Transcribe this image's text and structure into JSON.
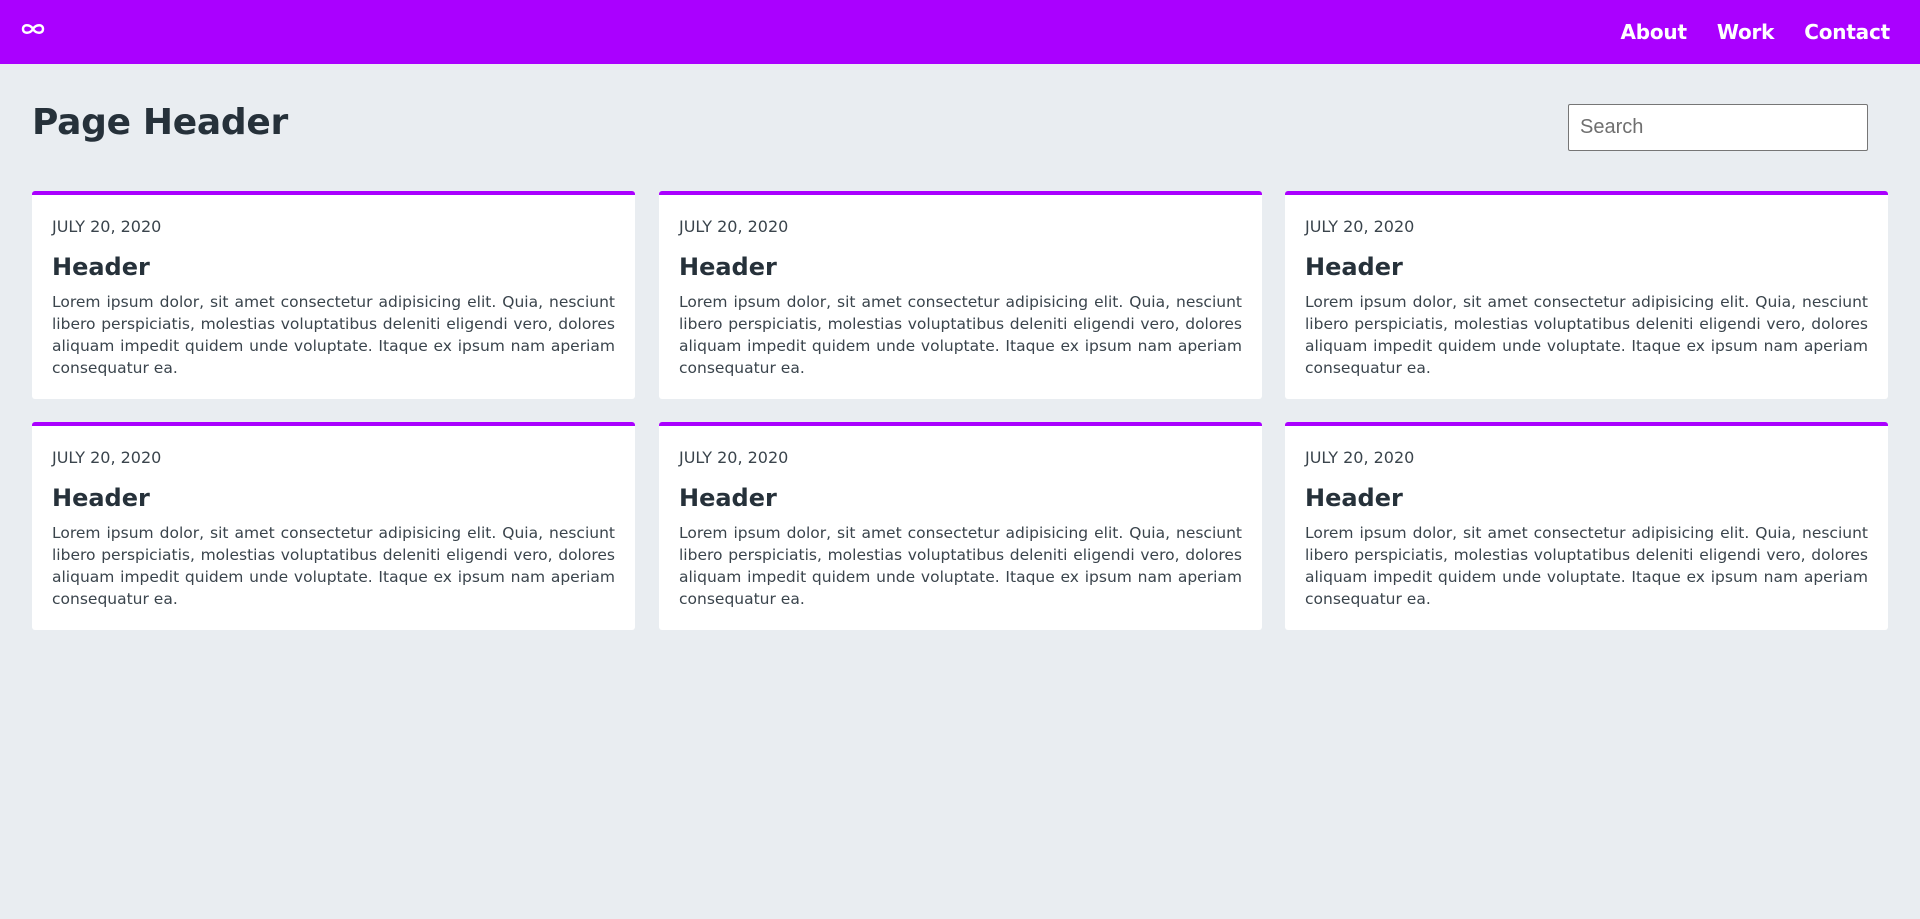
{
  "navbar": {
    "logo_icon": "infinity-icon",
    "links": [
      "About",
      "Work",
      "Contact"
    ],
    "background": "#aa00ff"
  },
  "page": {
    "title": "Page Header"
  },
  "search": {
    "placeholder": "Search",
    "value": ""
  },
  "cards": [
    {
      "date": "JULY 20, 2020",
      "header": "Header",
      "body": "Lorem ipsum dolor, sit amet consectetur adipisicing elit. Quia, nesciunt libero perspiciatis, molestias voluptatibus deleniti eligendi vero, dolores aliquam impedit quidem unde voluptate. Itaque ex ipsum nam aperiam consequatur ea."
    },
    {
      "date": "JULY 20, 2020",
      "header": "Header",
      "body": "Lorem ipsum dolor, sit amet consectetur adipisicing elit. Quia, nesciunt libero perspiciatis, molestias voluptatibus deleniti eligendi vero, dolores aliquam impedit quidem unde voluptate. Itaque ex ipsum nam aperiam consequatur ea."
    },
    {
      "date": "JULY 20, 2020",
      "header": "Header",
      "body": "Lorem ipsum dolor, sit amet consectetur adipisicing elit. Quia, nesciunt libero perspiciatis, molestias voluptatibus deleniti eligendi vero, dolores aliquam impedit quidem unde voluptate. Itaque ex ipsum nam aperiam consequatur ea."
    },
    {
      "date": "JULY 20, 2020",
      "header": "Header",
      "body": "Lorem ipsum dolor, sit amet consectetur adipisicing elit. Quia, nesciunt libero perspiciatis, molestias voluptatibus deleniti eligendi vero, dolores aliquam impedit quidem unde voluptate. Itaque ex ipsum nam aperiam consequatur ea."
    },
    {
      "date": "JULY 20, 2020",
      "header": "Header",
      "body": "Lorem ipsum dolor, sit amet consectetur adipisicing elit. Quia, nesciunt libero perspiciatis, molestias voluptatibus deleniti eligendi vero, dolores aliquam impedit quidem unde voluptate. Itaque ex ipsum nam aperiam consequatur ea."
    },
    {
      "date": "JULY 20, 2020",
      "header": "Header",
      "body": "Lorem ipsum dolor, sit amet consectetur adipisicing elit. Quia, nesciunt libero perspiciatis, molestias voluptatibus deleniti eligendi vero, dolores aliquam impedit quidem unde voluptate. Itaque ex ipsum nam aperiam consequatur ea."
    }
  ]
}
